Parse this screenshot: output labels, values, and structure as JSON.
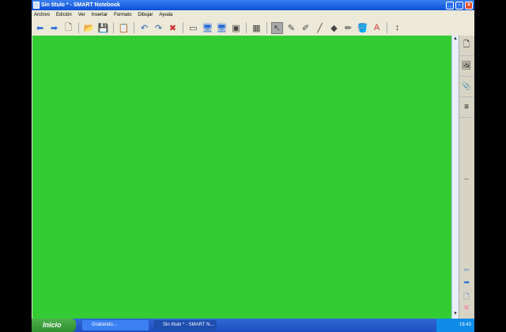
{
  "window": {
    "title": "Sin título * - SMART Notebook"
  },
  "menu": [
    "Archivo",
    "Edición",
    "Ver",
    "Insertar",
    "Formato",
    "Dibujar",
    "Ayuda"
  ],
  "toolbar": [
    {
      "icon": "back-arrow-icon",
      "glyph": "⬅"
    },
    {
      "icon": "forward-arrow-icon",
      "glyph": "➡"
    },
    {
      "icon": "add-page-icon",
      "glyph": "🗋"
    },
    {
      "sep": true
    },
    {
      "icon": "open-folder-icon",
      "glyph": "📂"
    },
    {
      "icon": "save-icon",
      "glyph": "💾"
    },
    {
      "sep": true
    },
    {
      "icon": "paste-icon",
      "glyph": "📋"
    },
    {
      "sep": true
    },
    {
      "icon": "undo-icon",
      "glyph": "↶"
    },
    {
      "icon": "redo-icon",
      "glyph": "↷"
    },
    {
      "icon": "delete-icon",
      "glyph": "✖"
    },
    {
      "sep": true
    },
    {
      "icon": "screen-shade-icon",
      "glyph": "▭"
    },
    {
      "icon": "full-screen-icon",
      "glyph": "🖥"
    },
    {
      "icon": "dual-page-icon",
      "glyph": "🖥"
    },
    {
      "icon": "screen-capture-icon",
      "glyph": "▣"
    },
    {
      "sep": true
    },
    {
      "icon": "table-icon",
      "glyph": "▦"
    },
    {
      "sep": true
    },
    {
      "icon": "select-pointer-icon",
      "glyph": "↖",
      "selected": true
    },
    {
      "icon": "pen-icon",
      "glyph": "✎"
    },
    {
      "icon": "creative-pen-icon",
      "glyph": "✐"
    },
    {
      "icon": "line-icon",
      "glyph": "╱"
    },
    {
      "icon": "shapes-icon",
      "glyph": "◆"
    },
    {
      "icon": "magic-pen-icon",
      "glyph": "✏"
    },
    {
      "icon": "fill-icon",
      "glyph": "🪣"
    },
    {
      "icon": "text-icon",
      "glyph": "A"
    },
    {
      "sep": true
    },
    {
      "icon": "move-toolbar-icon",
      "glyph": "↕"
    }
  ],
  "sidebar": [
    {
      "icon": "page-sorter-icon",
      "glyph": "🗋"
    },
    {
      "icon": "gallery-icon",
      "glyph": "🖼"
    },
    {
      "icon": "attachments-icon",
      "glyph": "📎"
    },
    {
      "icon": "properties-icon",
      "glyph": "≡"
    }
  ],
  "sidebar_bottom": [
    {
      "icon": "expand-icon",
      "glyph": "↔"
    },
    {
      "icon": "back-arrow-icon",
      "glyph": "⬅"
    },
    {
      "icon": "forward-arrow-icon",
      "glyph": "➡"
    },
    {
      "icon": "add-page-icon",
      "glyph": "🗋"
    },
    {
      "icon": "delete-icon",
      "glyph": "✖"
    }
  ],
  "canvas_color": "#33cc33",
  "taskbar": {
    "start": "Inicio",
    "tasks": [
      "Grabando...",
      "Sin título * - SMART N..."
    ],
    "clock": "16:43"
  }
}
